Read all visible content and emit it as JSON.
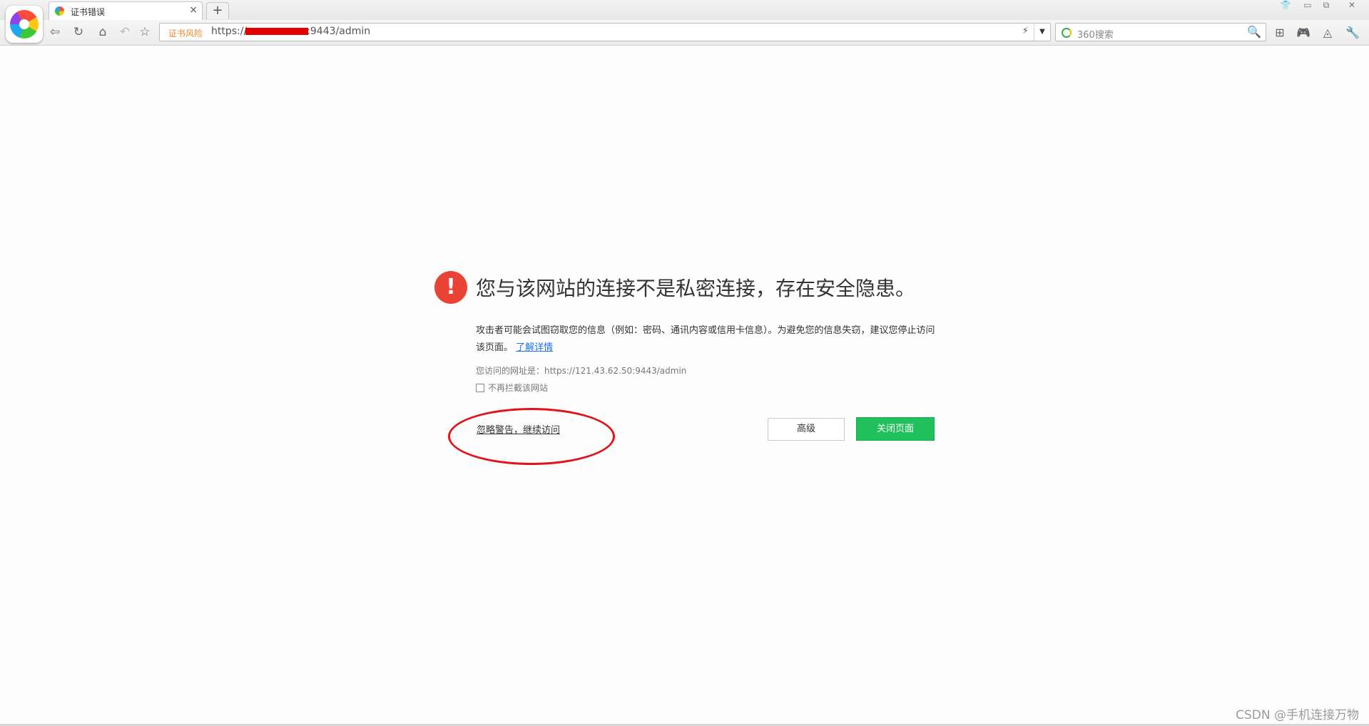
{
  "browser": {
    "tab": {
      "title": "证书错误",
      "close": "×"
    },
    "new_tab": "+",
    "window_controls": [
      "👕",
      "▭",
      "⧉",
      "✕"
    ],
    "address": {
      "cert_warning": "证书风险",
      "url_prefix": "https://",
      "url_suffix": ":9443/admin",
      "bolt": "⚡",
      "dropdown": "▼"
    },
    "search": {
      "placeholder": "360搜索",
      "icon": "🔍"
    },
    "nav_icons": {
      "back": "⇦",
      "refresh": "↻",
      "home": "⌂",
      "undo": "↶",
      "favorite": "☆"
    },
    "toolbar_icons": {
      "apps": "⊞",
      "game": "🎮",
      "extension": "◬",
      "tools": "🔧"
    }
  },
  "error_page": {
    "icon": "!",
    "title": "您与该网站的连接不是私密连接，存在安全隐患。",
    "description": "攻击者可能会试图窃取您的信息（例如：密码、通讯内容或信用卡信息）。为避免您的信息失窃，建议您停止访问该页面。",
    "learn_more": "了解详情",
    "visited_url": "您访问的网址是：https://121.43.62.50:9443/admin",
    "no_block_label": "不再拦截该网站",
    "ignore_link": "忽略警告，继续访问",
    "advanced_button": "高级",
    "close_button": "关闭页面"
  },
  "watermark": "CSDN @手机连接万物",
  "colors": {
    "error_red": "#ea4335",
    "primary_green": "#20c05c",
    "annotation_red": "#e0141a",
    "link_blue": "#1a73e8"
  }
}
